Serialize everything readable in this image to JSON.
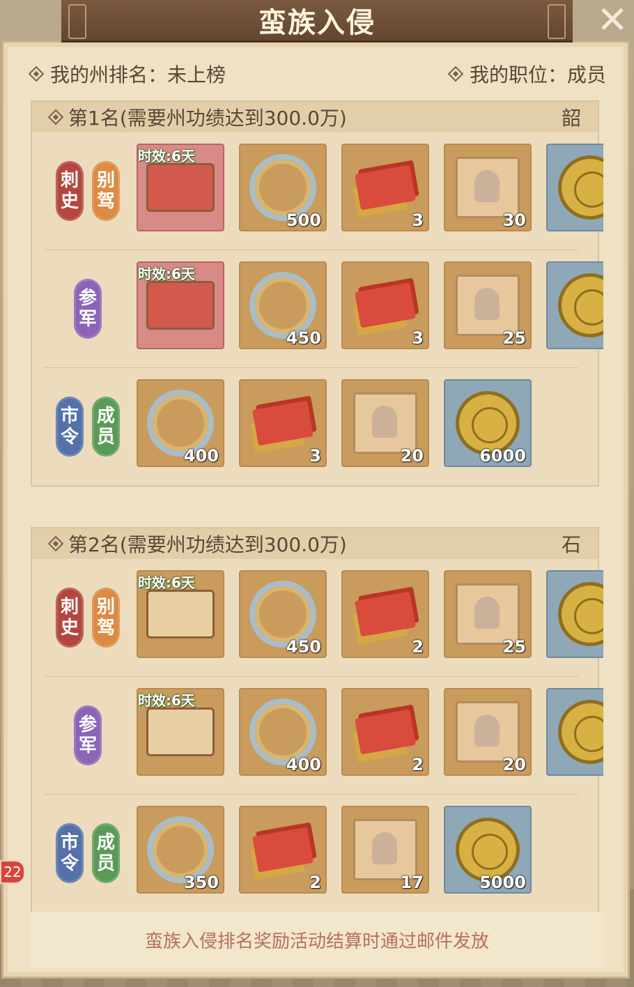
{
  "header": {
    "title": "蛮族入侵"
  },
  "info": {
    "my_rank": "我的州排名：未上榜",
    "my_position": "我的职位：成员"
  },
  "ranks": [
    {
      "header": "第1名(需要州功绩达到300.0万)",
      "tag": "韶",
      "tiers": [
        {
          "badges": [
            {
              "text": "刺史",
              "color": "#b3473f"
            },
            {
              "text": "别驾",
              "color": "#dd8a42"
            }
          ],
          "items": [
            {
              "icon": "red-decree-scroll-icon",
              "tag": "时效:6天",
              "qty": ""
            },
            {
              "icon": "silk-ribbon-icon",
              "tag": "",
              "qty": "500"
            },
            {
              "icon": "red-brick-icon",
              "tag": "",
              "qty": "3"
            },
            {
              "icon": "portrait-book-icon",
              "tag": "",
              "qty": "30"
            },
            {
              "icon": "gold-coin-icon",
              "tag": "",
              "qty": ""
            }
          ]
        },
        {
          "badges": [
            {
              "text": "参军",
              "color": "#8b64b8"
            }
          ],
          "items": [
            {
              "icon": "red-decree-scroll-icon",
              "tag": "时效:6天",
              "qty": ""
            },
            {
              "icon": "silk-ribbon-icon",
              "tag": "",
              "qty": "450"
            },
            {
              "icon": "red-brick-icon",
              "tag": "",
              "qty": "3"
            },
            {
              "icon": "portrait-book-icon",
              "tag": "",
              "qty": "25"
            },
            {
              "icon": "gold-coin-icon",
              "tag": "",
              "qty": ""
            }
          ]
        },
        {
          "badges": [
            {
              "text": "市令",
              "color": "#5571a8"
            },
            {
              "text": "成员",
              "color": "#5a9a58"
            }
          ],
          "items": [
            {
              "icon": "silk-ribbon-icon",
              "tag": "",
              "qty": "400"
            },
            {
              "icon": "red-brick-icon",
              "tag": "",
              "qty": "3"
            },
            {
              "icon": "portrait-book-icon",
              "tag": "",
              "qty": "20"
            },
            {
              "icon": "gold-coin-icon",
              "tag": "",
              "qty": "6000"
            }
          ]
        }
      ]
    },
    {
      "header": "第2名(需要州功绩达到300.0万)",
      "tag": "石",
      "tiers": [
        {
          "badges": [
            {
              "text": "刺史",
              "color": "#b3473f"
            },
            {
              "text": "别驾",
              "color": "#dd8a42"
            }
          ],
          "items": [
            {
              "icon": "beige-decree-scroll-icon",
              "tag": "时效:6天",
              "qty": ""
            },
            {
              "icon": "silk-ribbon-icon",
              "tag": "",
              "qty": "450"
            },
            {
              "icon": "red-brick-icon",
              "tag": "",
              "qty": "2"
            },
            {
              "icon": "portrait-book-icon",
              "tag": "",
              "qty": "25"
            },
            {
              "icon": "gold-coin-icon",
              "tag": "",
              "qty": ""
            }
          ]
        },
        {
          "badges": [
            {
              "text": "参军",
              "color": "#8b64b8"
            }
          ],
          "items": [
            {
              "icon": "beige-decree-scroll-icon",
              "tag": "时效:6天",
              "qty": ""
            },
            {
              "icon": "silk-ribbon-icon",
              "tag": "",
              "qty": "400"
            },
            {
              "icon": "red-brick-icon",
              "tag": "",
              "qty": "2"
            },
            {
              "icon": "portrait-book-icon",
              "tag": "",
              "qty": "20"
            },
            {
              "icon": "gold-coin-icon",
              "tag": "",
              "qty": ""
            }
          ]
        },
        {
          "badges": [
            {
              "text": "市令",
              "color": "#5571a8"
            },
            {
              "text": "成员",
              "color": "#5a9a58"
            }
          ],
          "items": [
            {
              "icon": "silk-ribbon-icon",
              "tag": "",
              "qty": "350"
            },
            {
              "icon": "red-brick-icon",
              "tag": "",
              "qty": "2"
            },
            {
              "icon": "portrait-book-icon",
              "tag": "",
              "qty": "17"
            },
            {
              "icon": "gold-coin-icon",
              "tag": "",
              "qty": "5000"
            }
          ]
        }
      ]
    }
  ],
  "footer": {
    "text": "蛮族入侵排名奖励活动结算时通过邮件发放"
  },
  "side_badge": {
    "count": "22"
  }
}
